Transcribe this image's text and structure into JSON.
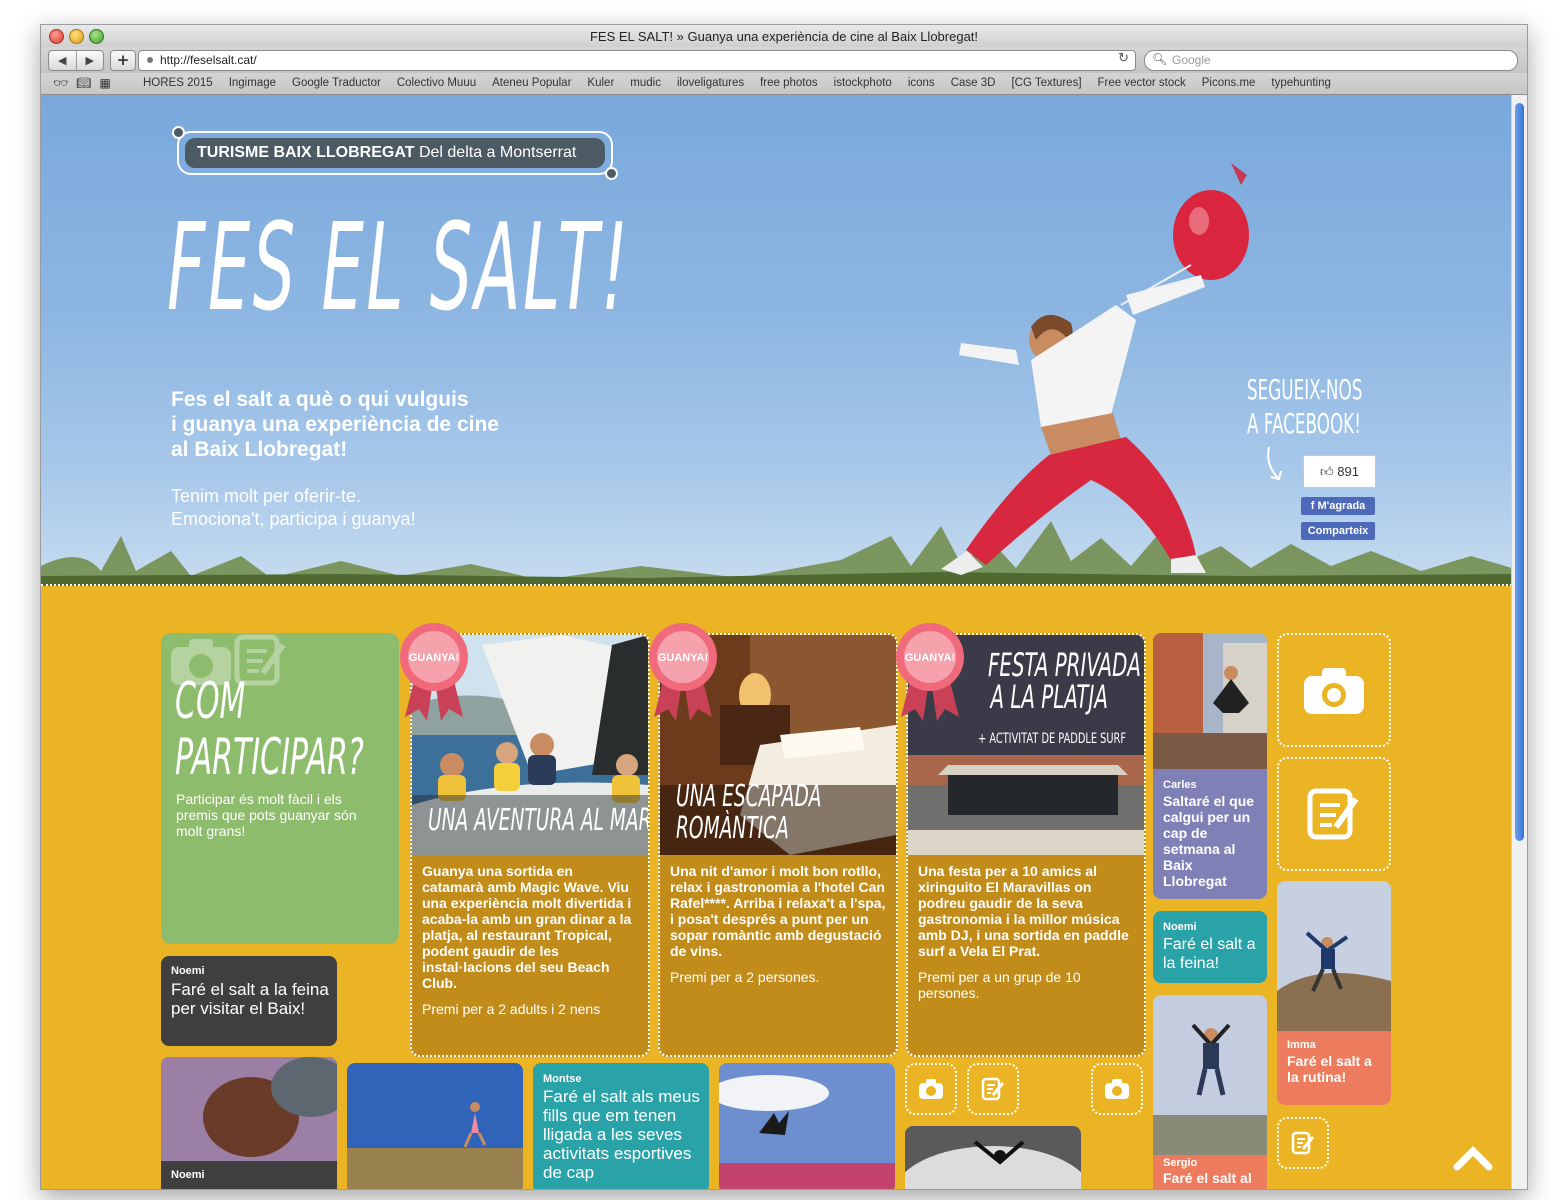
{
  "browser": {
    "window_title": "FES EL SALT! » Guanya una experiència de cine al Baix Llobregat!",
    "url": "http://feselsalt.cat/",
    "search_placeholder": "Google",
    "nav_back": "◀",
    "nav_forward": "▶",
    "add": "+",
    "bookmarks": [
      "HORES 2015",
      "Ingimage",
      "Google Traductor",
      "Colectivo Muuu",
      "Ateneu Popular",
      "Kuler",
      "mudic",
      "iloveligatures",
      "free photos",
      "istockphoto",
      "icons",
      "Case 3D",
      "[CG Textures]",
      "Free vector stock",
      "Picons.me",
      "typehunting"
    ]
  },
  "hero": {
    "brand_bold": "TURISME BAIX LLOBREGAT",
    "brand_rest": "Del delta a Montserrat",
    "title": "FES EL SALT!",
    "tagline_1": "Fes el salt a què o qui vulguis",
    "tagline_2": "i guanya una experiència de cine",
    "tagline_3": "al Baix Llobregat!",
    "sub_1": "Tenim molt per oferir-te.",
    "sub_2": "Emociona't, participa i guanya!",
    "follow_1": "SEGUEIX-NOS",
    "follow_2": "A FACEBOOK!",
    "like_count": "891",
    "like_label": "M'agrada",
    "share_label": "Comparteix"
  },
  "participar": {
    "title_1": "COM",
    "title_2": "PARTICIPAR?",
    "desc": "Participar és molt fàcil i els premis que pots guanyar són molt grans!"
  },
  "badge_label": "GUANYA!",
  "prizes": [
    {
      "title_1": "UNA AVENTURA AL MAR",
      "desc": "Guanya una sortida en catamarà amb Magic Wave. Viu una experiència molt divertida i acaba-la amb un gran dinar a la platja, al restaurant Tropical, podent gaudir de les instal·lacions del seu Beach Club.",
      "note": "Premi per a 2 adults i 2 nens"
    },
    {
      "title_1": "UNA ESCAPADA",
      "title_2": "ROMÀNTICA",
      "desc": "Una nit d'amor i molt bon rotllo, relax i gastronomia a l'hotel Can Rafel****. Arriba i relaxa't a l'spa, i posa't després a punt per un sopar romàntic amb degustació de vins.",
      "note": "Premi per a 2 persones."
    },
    {
      "title_1": "FESTA PRIVADA",
      "title_2": "A LA PLATJA",
      "title_3": "+ ACTIVITAT DE PADDLE SURF",
      "desc": "Una festa per a 10 amics al xiringuito El Maravillas on podreu gaudir de la seva gastronomia i la millor música amb DJ, i una sortida en paddle surf a Vela El Prat.",
      "note": "Premi per a un grup de 10 persones."
    }
  ],
  "posts": {
    "noemi1_name": "Noemi",
    "noemi1_text": "Faré el salt a la feina per visitar el Baix!",
    "carles_name": "Carles",
    "carles_text": "Saltaré el que calgui per un cap de setmana al Baix Llobregat",
    "noemi2_name": "Noemi",
    "noemi2_text": "Faré el salt a la feina!",
    "imma_name": "Imma",
    "imma_text": "Faré el salt a la rutina!",
    "montse_name": "Montse",
    "montse_text": "Faré el salt als meus fills que em tenen lligada a les seves activitats esportives de cap",
    "noemi3_name": "Noemi",
    "sergio_name": "Sergio",
    "sergio_text": "Faré el salt al"
  }
}
